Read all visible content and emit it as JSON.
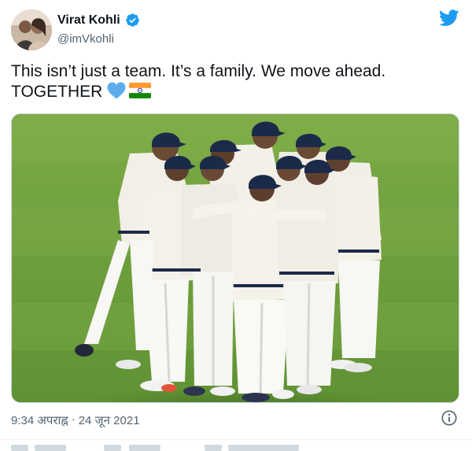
{
  "author": {
    "name": "Virat Kohli",
    "handle": "@imVkohli",
    "verified": true,
    "avatar_icon": "profile-photo-avatar"
  },
  "tweet": {
    "line1": "This isn’t just a team. It’s a family. We move ahead.",
    "line2": "TOGETHER",
    "emojis": [
      "blue-heart-emoji",
      "india-flag-emoji"
    ]
  },
  "photo": {
    "icon": "team-huddle-photo"
  },
  "meta": {
    "time": "9:34 अपराह्न",
    "separator": "·",
    "date": "24 जून 2021"
  },
  "colors": {
    "brand": "#1d9bf0",
    "text": "#0f1419",
    "muted": "#536471",
    "field": "#6fa03c"
  }
}
